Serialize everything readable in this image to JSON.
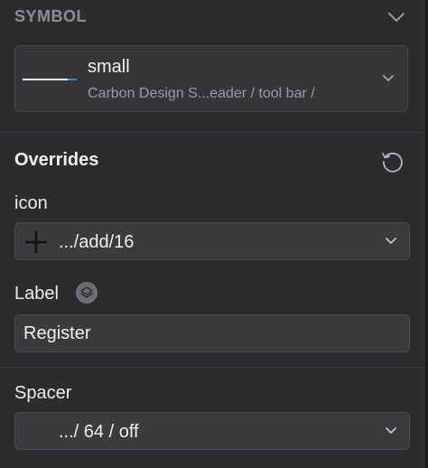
{
  "symbol": {
    "section_title": "SYMBOL",
    "name": "small",
    "path": "Carbon Design S...eader / tool bar /"
  },
  "overrides": {
    "title": "Overrides",
    "icon_label": "icon",
    "icon_value": ".../add/16",
    "label_label": "Label",
    "label_value": "Register",
    "spacer_label": "Spacer",
    "spacer_value": ".../ 64 / off"
  },
  "icons": {
    "collapse": "chevron-down-icon",
    "symbol_dropdown": "chevron-down-icon",
    "reset": "reset-overrides-icon",
    "icon_glyph": "plus-icon",
    "label_type": "layers-icon"
  },
  "colors": {
    "background": "#2b2c2e",
    "field": "#3a3b3d",
    "accent_line": "#4a7cf5",
    "muted_text": "#8e8e92"
  }
}
